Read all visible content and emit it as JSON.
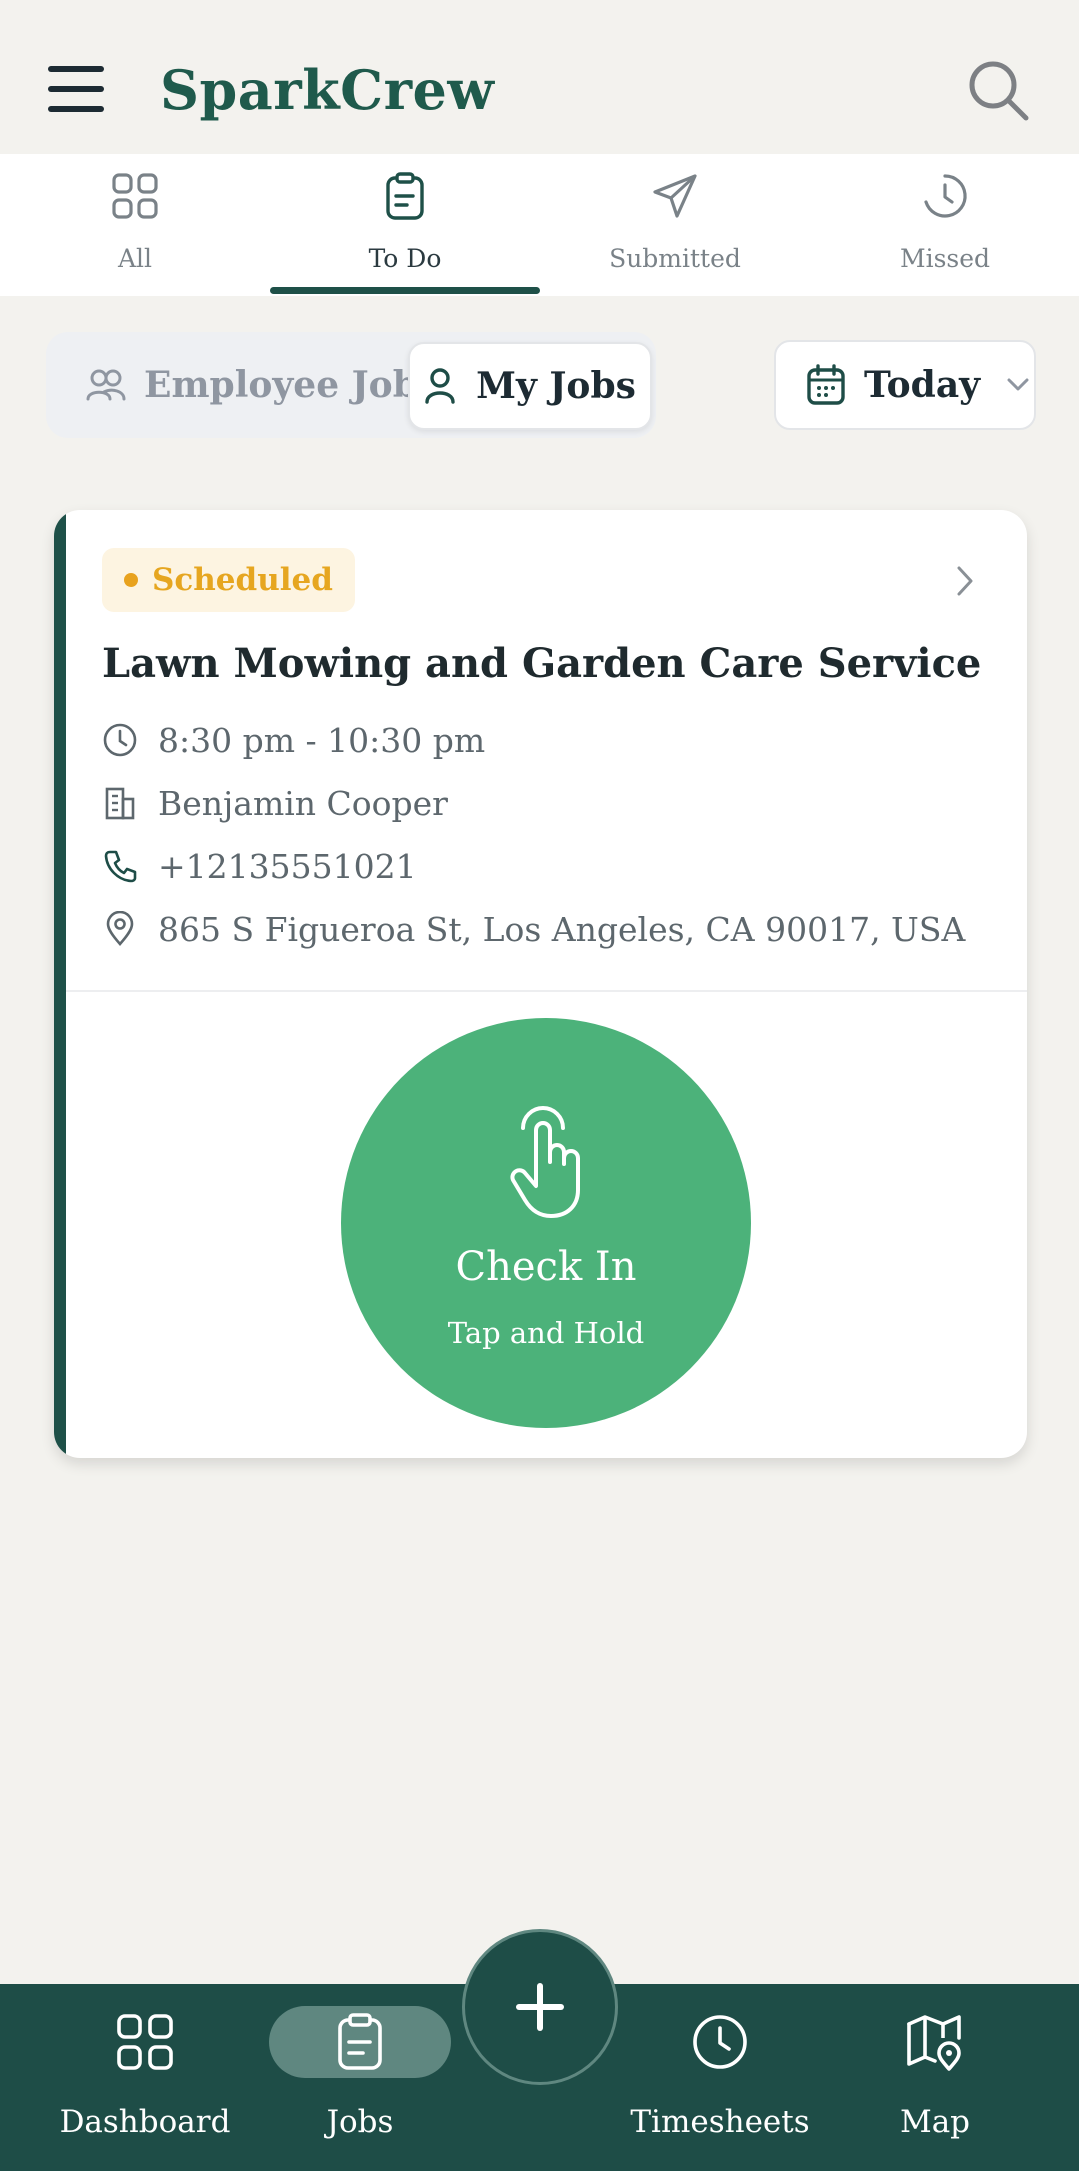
{
  "app": {
    "title": "SparkCrew"
  },
  "header": {
    "menu_icon": "hamburger-menu-icon",
    "search_icon": "search-icon"
  },
  "filter_tabs": [
    {
      "label": "All",
      "icon": "grid-icon",
      "active": false
    },
    {
      "label": "To Do",
      "icon": "clipboard-icon",
      "active": true
    },
    {
      "label": "Submitted",
      "icon": "paper-plane-icon",
      "active": false
    },
    {
      "label": "Missed",
      "icon": "clock-history-icon",
      "active": false
    }
  ],
  "scope_toggle": {
    "employee_jobs": "Employee Jobs",
    "my_jobs": "My Jobs",
    "selected": "My Jobs"
  },
  "date_filter": {
    "label": "Today",
    "icon": "calendar-icon"
  },
  "job": {
    "status": "Scheduled",
    "title": "Lawn Mowing and Garden Care Service",
    "time": "8:30 pm - 10:30 pm",
    "client": "Benjamin Cooper",
    "phone": "+12135551021",
    "address": "865 S Figueroa St, Los Angeles, CA 90017, USA"
  },
  "check_in": {
    "label": "Check In",
    "hint": "Tap and Hold"
  },
  "bottom_nav": [
    {
      "label": "Dashboard",
      "icon": "grid-icon",
      "active": false
    },
    {
      "label": "Jobs",
      "icon": "clipboard-icon",
      "active": true
    },
    {
      "label": "Timesheets",
      "icon": "clock-icon",
      "active": false
    },
    {
      "label": "Map",
      "icon": "map-pin-icon",
      "active": false
    }
  ],
  "fab": {
    "icon": "plus-icon"
  },
  "colors": {
    "brand": "#1f5a4c",
    "nav_bg": "#1e4d47",
    "accent_green": "#4cb27a",
    "scheduled": "#e6a620"
  }
}
